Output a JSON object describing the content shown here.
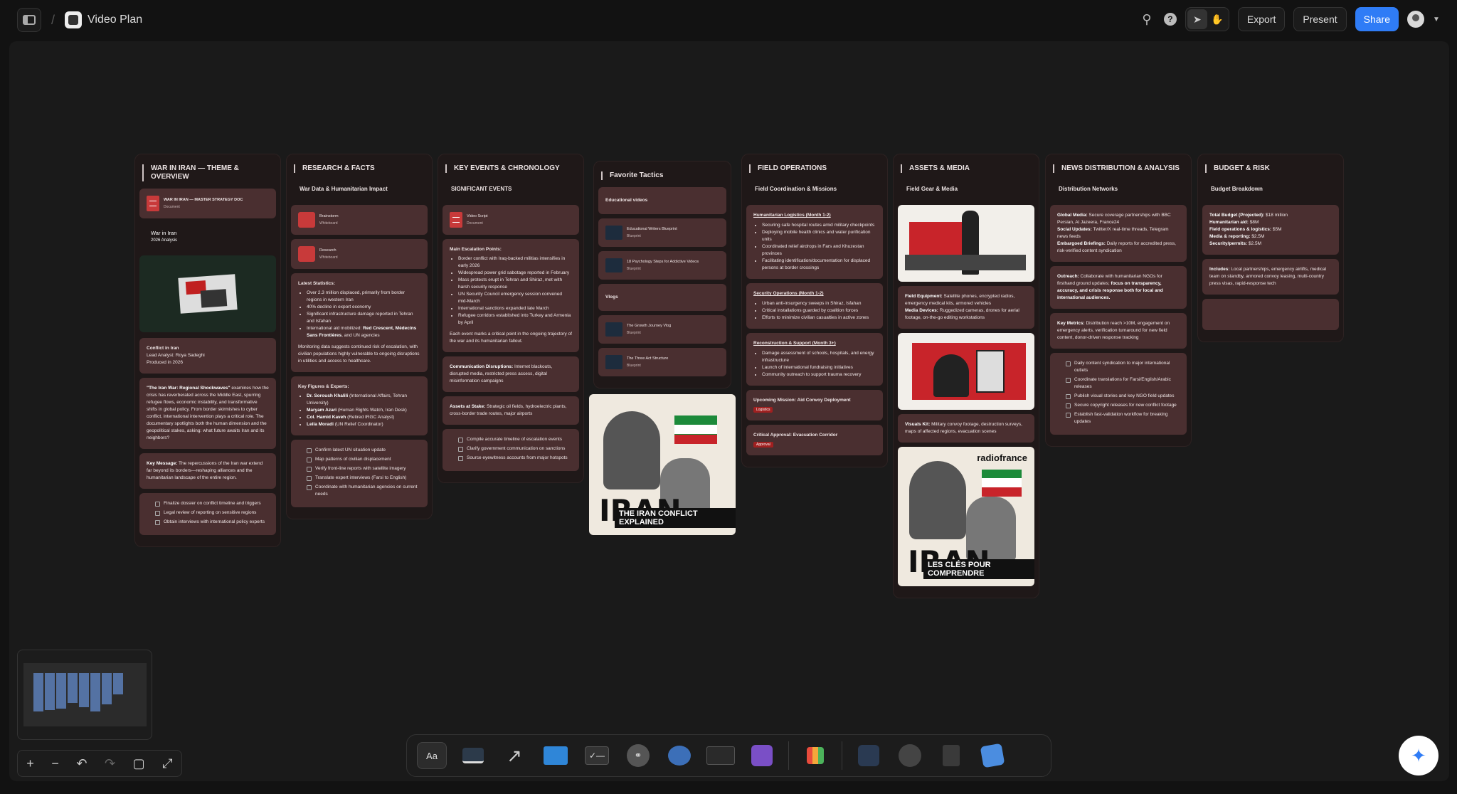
{
  "header": {
    "title": "Video Plan",
    "export": "Export",
    "present": "Present",
    "share": "Share"
  },
  "columns": {
    "c1": {
      "title": "WAR IN IRAN — THEME & OVERVIEW",
      "doc_title": "WAR IN IRAN — MASTER STRATEGY DOC",
      "doc_type": "Document",
      "analysis_title": "War in Iran",
      "analysis_sub": "2026 Analysis",
      "conflict_title": "Conflict in Iran",
      "lead_analyst": "Lead Analyst: Roya Sadeghi",
      "produced": "Produced in 2026",
      "summary_bold": "\"The Iran War: Regional Shockwaves\"",
      "summary_rest": " examines how the crisis has reverberated across the Middle East, spurring refugee flows, economic instability, and transformative shifts in global policy. From border skirmishes to cyber conflict, international intervention plays a critical role. The documentary spotlights both the human dimension and the geopolitical stakes, asking: what future awaits Iran and its neighbors?",
      "key_bold": "Key Message:",
      "key_rest": " The repercussions of the Iran war extend far beyond its borders—reshaping alliances and the humanitarian landscape of the entire region.",
      "tasks": [
        "Finalize dossier on conflict timeline and triggers",
        "Legal review of reporting on sensitive regions",
        "Obtain interviews with international policy experts"
      ]
    },
    "c2": {
      "title": "RESEARCH & FACTS",
      "sub": "War Data & Humanitarian Impact",
      "wb1": "Brainstorm",
      "wb1_type": "Whiteboard",
      "wb2": "Research",
      "wb2_type": "Whiteboard",
      "stats_title": "Latest Statistics:",
      "stats": [
        "Over 2.3 million displaced, primarily from border regions in western Iran",
        "40% decline in export economy",
        "Significant infrastructure damage reported in Tehran and Isfahan"
      ],
      "aid_pre": "International aid mobilized: ",
      "aid_bold": "Red Crescent, Médecins Sans Frontières",
      "aid_post": ", and UN agencies",
      "monitoring": "Monitoring data suggests continued risk of escalation, with civilian populations highly vulnerable to ongoing disruptions in utilities and access to healthcare.",
      "figures_title": "Key Figures & Experts:",
      "figures": [
        {
          "name": "Dr. Soroush Khalili",
          "role": " (International Affairs, Tehran University)"
        },
        {
          "name": "Maryam Azari",
          "role": " (Human Rights Watch, Iran Desk)"
        },
        {
          "name": "Col. Hamid Kaveh",
          "role": " (Retired IRGC Analyst)"
        },
        {
          "name": "Leila Moradi",
          "role": " (UN Relief Coordinator)"
        }
      ],
      "tasks": [
        "Confirm latest UN situation update",
        "Map patterns of civilian displacement",
        "Verify front-line reports with satellite imagery",
        "Translate expert interviews (Farsi to English)",
        "Coordinate with humanitarian agencies on current needs"
      ]
    },
    "c3": {
      "title": "KEY EVENTS & CHRONOLOGY",
      "sub": "SIGNIFICANT EVENTS",
      "doc": "Video Script",
      "doc_type": "Document",
      "main_title": "Main Escalation Points:",
      "points": [
        "Border conflict with Iraq-backed militias intensifies in early 2026",
        "Widespread power grid sabotage reported in February",
        "Mass protests erupt in Tehran and Shiraz, met with harsh security response",
        "UN Security Council emergency session convened mid-March",
        "International sanctions expanded late March",
        "Refugee corridors established into Turkey and Armenia by April"
      ],
      "note": "Each event marks a critical point in the ongoing trajectory of the war and its humanitarian fallout.",
      "comm_bold": "Communication Disruptions:",
      "comm_rest": " Internet blackouts, disrupted media, restricted press access, digital misinformation campaigns",
      "assets_bold": "Assets at Stake:",
      "assets_rest": " Strategic oil fields, hydroelectric plants, cross-border trade routes, major airports",
      "tasks": [
        "Compile accurate timeline of escalation events",
        "Clarify government communication on sanctions",
        "Source eyewitness accounts from major hotspots"
      ]
    },
    "c4": {
      "title": "Favorite Tactics",
      "edu": "Educational videos",
      "items1": [
        {
          "t": "Educational Writers Blueprint",
          "s": "Blueprint"
        },
        {
          "t": "18 Psychology Steps for Addictive Videos",
          "s": "Blueprint"
        }
      ],
      "vlogs": "Vlogs",
      "items2": [
        {
          "t": "The Growth Journey Vlog",
          "s": "Blueprint"
        },
        {
          "t": "The Three Act Structure",
          "s": "Blueprint"
        }
      ],
      "poster_title": "IRAN",
      "poster_sub": "THE IRAN CONFLICT EXPLAINED"
    },
    "c5": {
      "title": "FIELD OPERATIONS",
      "sub": "Field Coordination & Missions",
      "s1": "Humanitarian Logistics (Month 1-2)",
      "s1i": [
        "Securing safe hospital routes amid military checkpoints",
        "Deploying mobile health clinics and water purification units",
        "Coordinated relief airdrops in Fars and Khuzestan provinces",
        "Facilitating identification/documentation for displaced persons at border crossings"
      ],
      "s2": "Security Operations (Month 1-2)",
      "s2i": [
        "Urban anti-insurgency sweeps in Shiraz, Isfahan",
        "Critical installations guarded by coalition forces",
        "Efforts to minimize civilian casualties in active zones"
      ],
      "s3": "Reconstruction & Support (Month 3+)",
      "s3i": [
        "Damage assessment of schools, hospitals, and energy infrastructure",
        "Launch of international fundraising initiatives",
        "Community outreach to support trauma recovery"
      ],
      "m1": "Upcoming Mission: Aid Convoy Deployment",
      "m1b": "Logistics",
      "m2": "Critical Approval: Evacuation Corridor",
      "m2b": "Approval"
    },
    "c6": {
      "title": "ASSETS & MEDIA",
      "sub": "Field Gear & Media",
      "equip_bold": "Field Equipment:",
      "equip_rest": " Satellite phones, encrypted radios, emergency medical kits, armored vehicles",
      "media_bold": "Media Devices:",
      "media_rest": " Ruggedized cameras, drones for aerial footage, on-the-go editing workstations",
      "visuals_bold": "Visuals Kit:",
      "visuals_rest": " Military convoy footage, destruction surveys, maps of affected regions, evacuation scenes",
      "poster_brand": "radiofrance",
      "poster_title": "IRAN",
      "poster_sub": "LES CLÉS POUR COMPRENDRE"
    },
    "c7": {
      "title": "NEWS DISTRIBUTION & ANALYSIS",
      "sub": "Distribution Networks",
      "gm_b": "Global Media:",
      "gm": " Secure coverage partnerships with BBC Persian, Al Jazeera, France24",
      "su_b": "Social Updates:",
      "su": " Twitter/X real-time threads, Telegram news feeds",
      "eb_b": "Embargoed Briefings:",
      "eb": " Daily reports for accredited press, risk-verified content syndication",
      "out_b": "Outreach:",
      "out": " Collaborate with humanitarian NGOs for firsthand ground updates; ",
      "out_b2": "focus on transparency, accuracy, and crisis response both for local and international audiences.",
      "km_b": "Key Metrics:",
      "km": " Distribution reach >10M, engagement on emergency alerts, verification turnaround for new field content, donor-driven response tracking",
      "tasks": [
        "Daily content syndication to major international outlets",
        "Coordinate translations for Farsi/English/Arabic releases",
        "Publish visual stories and key NGO field updates",
        "Secure copyright releases for new conflict footage",
        "Establish fast-validation workflow for breaking updates"
      ]
    },
    "c8": {
      "title": "BUDGET & RISK",
      "sub": "Budget Breakdown",
      "lines": [
        {
          "k": "Total Budget (Projected):",
          "v": " $18 million"
        },
        {
          "k": "Humanitarian aid:",
          "v": " $8M"
        },
        {
          "k": "Field operations & logistics:",
          "v": " $5M"
        },
        {
          "k": "Media & reporting:",
          "v": " $2.5M"
        },
        {
          "k": "Security/permits:",
          "v": " $2.5M"
        }
      ],
      "inc_b": "Includes:",
      "inc": " Local partnerships, emergency airlifts, medical team on standby, armored convoy leasing, multi-country press visas, rapid-response tech"
    }
  },
  "dock": {
    "text_tool": "Aa"
  },
  "icons": [
    "sidebar-toggle-icon",
    "search-icon",
    "help-icon",
    "pointer-icon",
    "hand-icon",
    "sparkle-icon"
  ]
}
